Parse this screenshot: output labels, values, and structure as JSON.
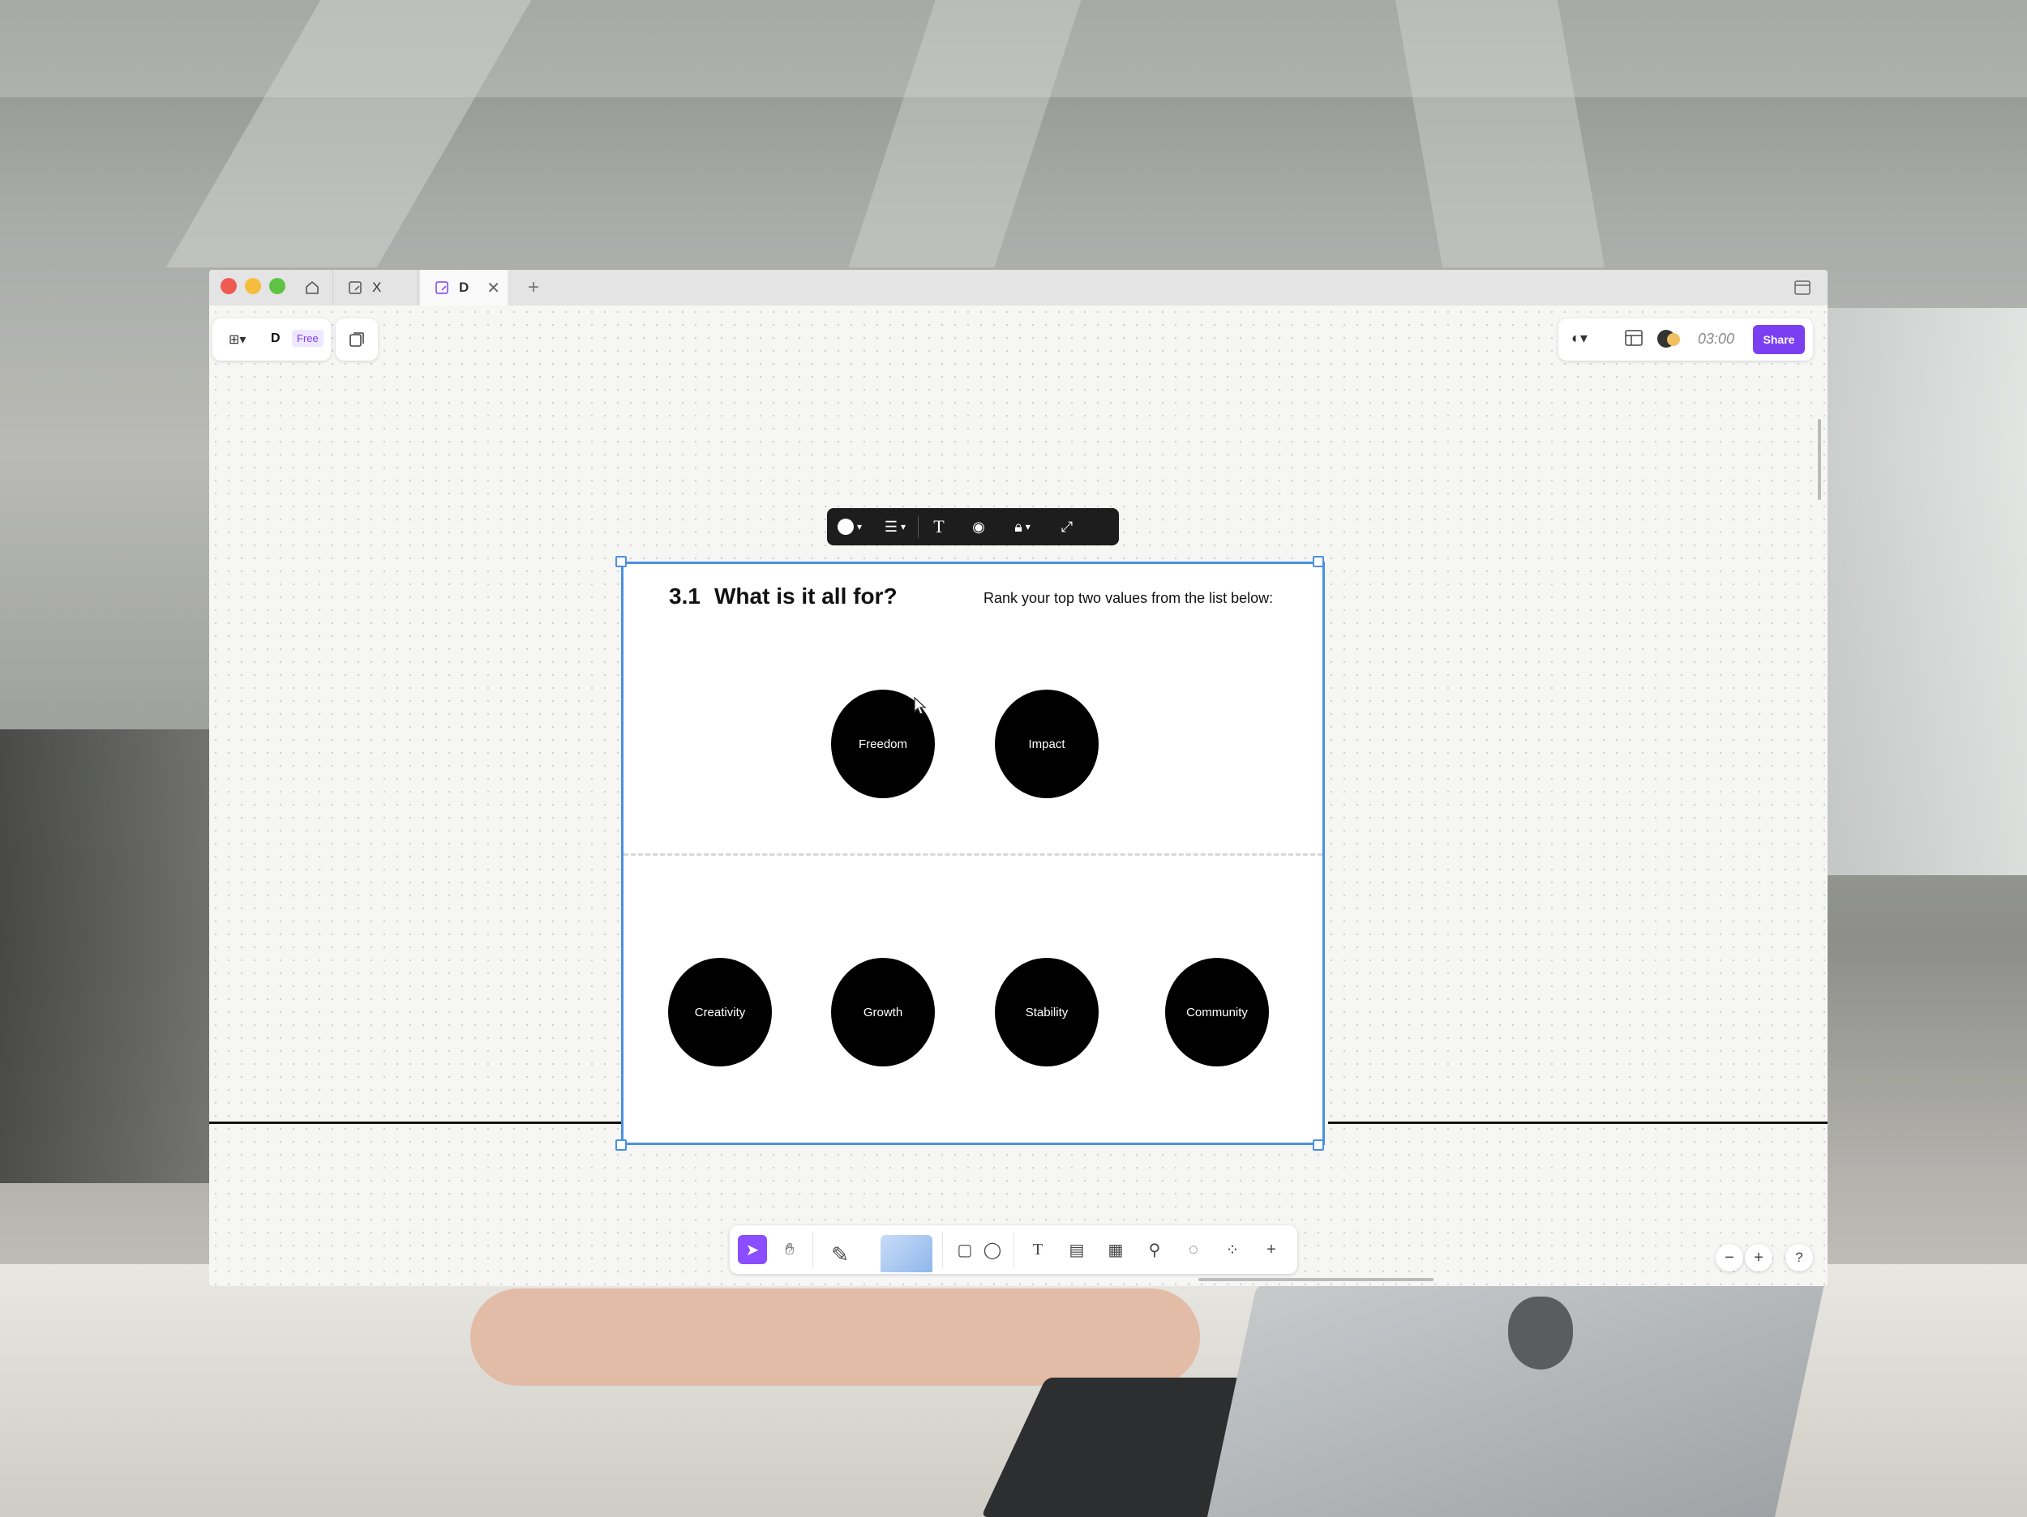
{
  "tabs": [
    {
      "label": "X"
    },
    {
      "label": "D"
    }
  ],
  "file": {
    "name": "D",
    "plan_badge": "Free"
  },
  "top_right": {
    "timer": "03:00",
    "share_label": "Share"
  },
  "frame": {
    "section_number": "3.1",
    "title": "What is it all for?",
    "instruction": "Rank your top two values from the list below:",
    "top_values": [
      "Freedom",
      "Impact"
    ],
    "bottom_values": [
      "Creativity",
      "Growth",
      "Stability",
      "Community"
    ]
  },
  "zoom_controls": {
    "minus": "−",
    "plus": "+",
    "help": "?"
  },
  "colors": {
    "accent": "#7b3ff2",
    "selection": "#4a90e2"
  }
}
